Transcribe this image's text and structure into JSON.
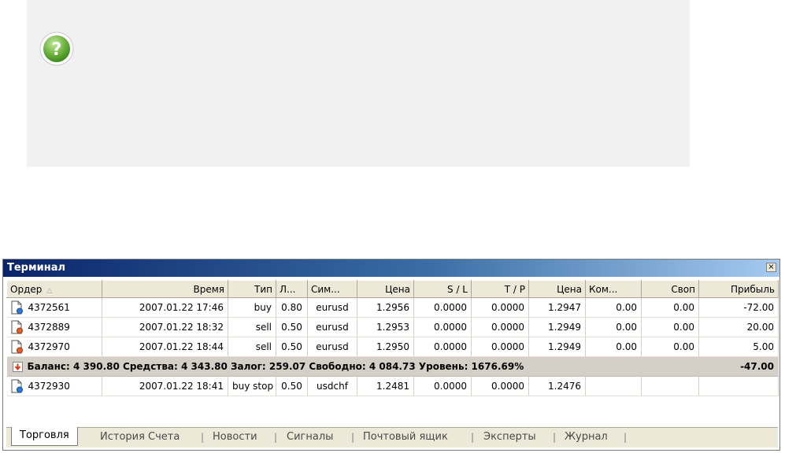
{
  "terminal": {
    "title": "Терминал",
    "close_glyph": "×",
    "columns": [
      "Ордер",
      "Время",
      "Тип",
      "Л...",
      "Сим...",
      "Цена",
      "S / L",
      "T / P",
      "Цена",
      "Ком...",
      "Своп",
      "Прибыль"
    ],
    "sort_arrow": "△",
    "rows": [
      {
        "order": "4372561",
        "time": "2007.01.22 17:46",
        "type": "buy",
        "lots": "0.80",
        "symbol": "eurusd",
        "open_price": "1.2956",
        "sl": "0.0000",
        "tp": "0.0000",
        "price": "1.2947",
        "commission": "0.00",
        "swap": "0.00",
        "profit": "-72.00",
        "icon": "buy-order-icon"
      },
      {
        "order": "4372889",
        "time": "2007.01.22 18:32",
        "type": "sell",
        "lots": "0.50",
        "symbol": "eurusd",
        "open_price": "1.2953",
        "sl": "0.0000",
        "tp": "0.0000",
        "price": "1.2949",
        "commission": "0.00",
        "swap": "0.00",
        "profit": "20.00",
        "icon": "sell-order-icon"
      },
      {
        "order": "4372970",
        "time": "2007.01.22 18:44",
        "type": "sell",
        "lots": "0.50",
        "symbol": "eurusd",
        "open_price": "1.2950",
        "sl": "0.0000",
        "tp": "0.0000",
        "price": "1.2949",
        "commission": "0.00",
        "swap": "0.00",
        "profit": "5.00",
        "icon": "sell-order-icon"
      }
    ],
    "summary": {
      "text": "Баланс: 4 390.80  Средства: 4 343.80  Залог: 259.07  Свободно: 4 084.73  Уровень: 1676.69%",
      "profit": "-47.00"
    },
    "pending": {
      "order": "4372930",
      "time": "2007.01.22 18:41",
      "type": "buy stop",
      "lots": "0.50",
      "symbol": "usdchf",
      "open_price": "1.2481",
      "sl": "0.0000",
      "tp": "0.0000",
      "price": "1.2476",
      "commission": "",
      "swap": "",
      "profit": ""
    },
    "tabs": [
      "Торговля",
      "История Счета",
      "Новости",
      "Сигналы",
      "Почтовый ящик",
      "Эксперты",
      "Журнал"
    ],
    "active_tab": "Торговля"
  },
  "colors": {
    "title_gradient_start": "#0a246a",
    "title_gradient_end": "#a6caf0",
    "note_bg": "#f1f1f1",
    "help_icon": "#6cb33f"
  }
}
